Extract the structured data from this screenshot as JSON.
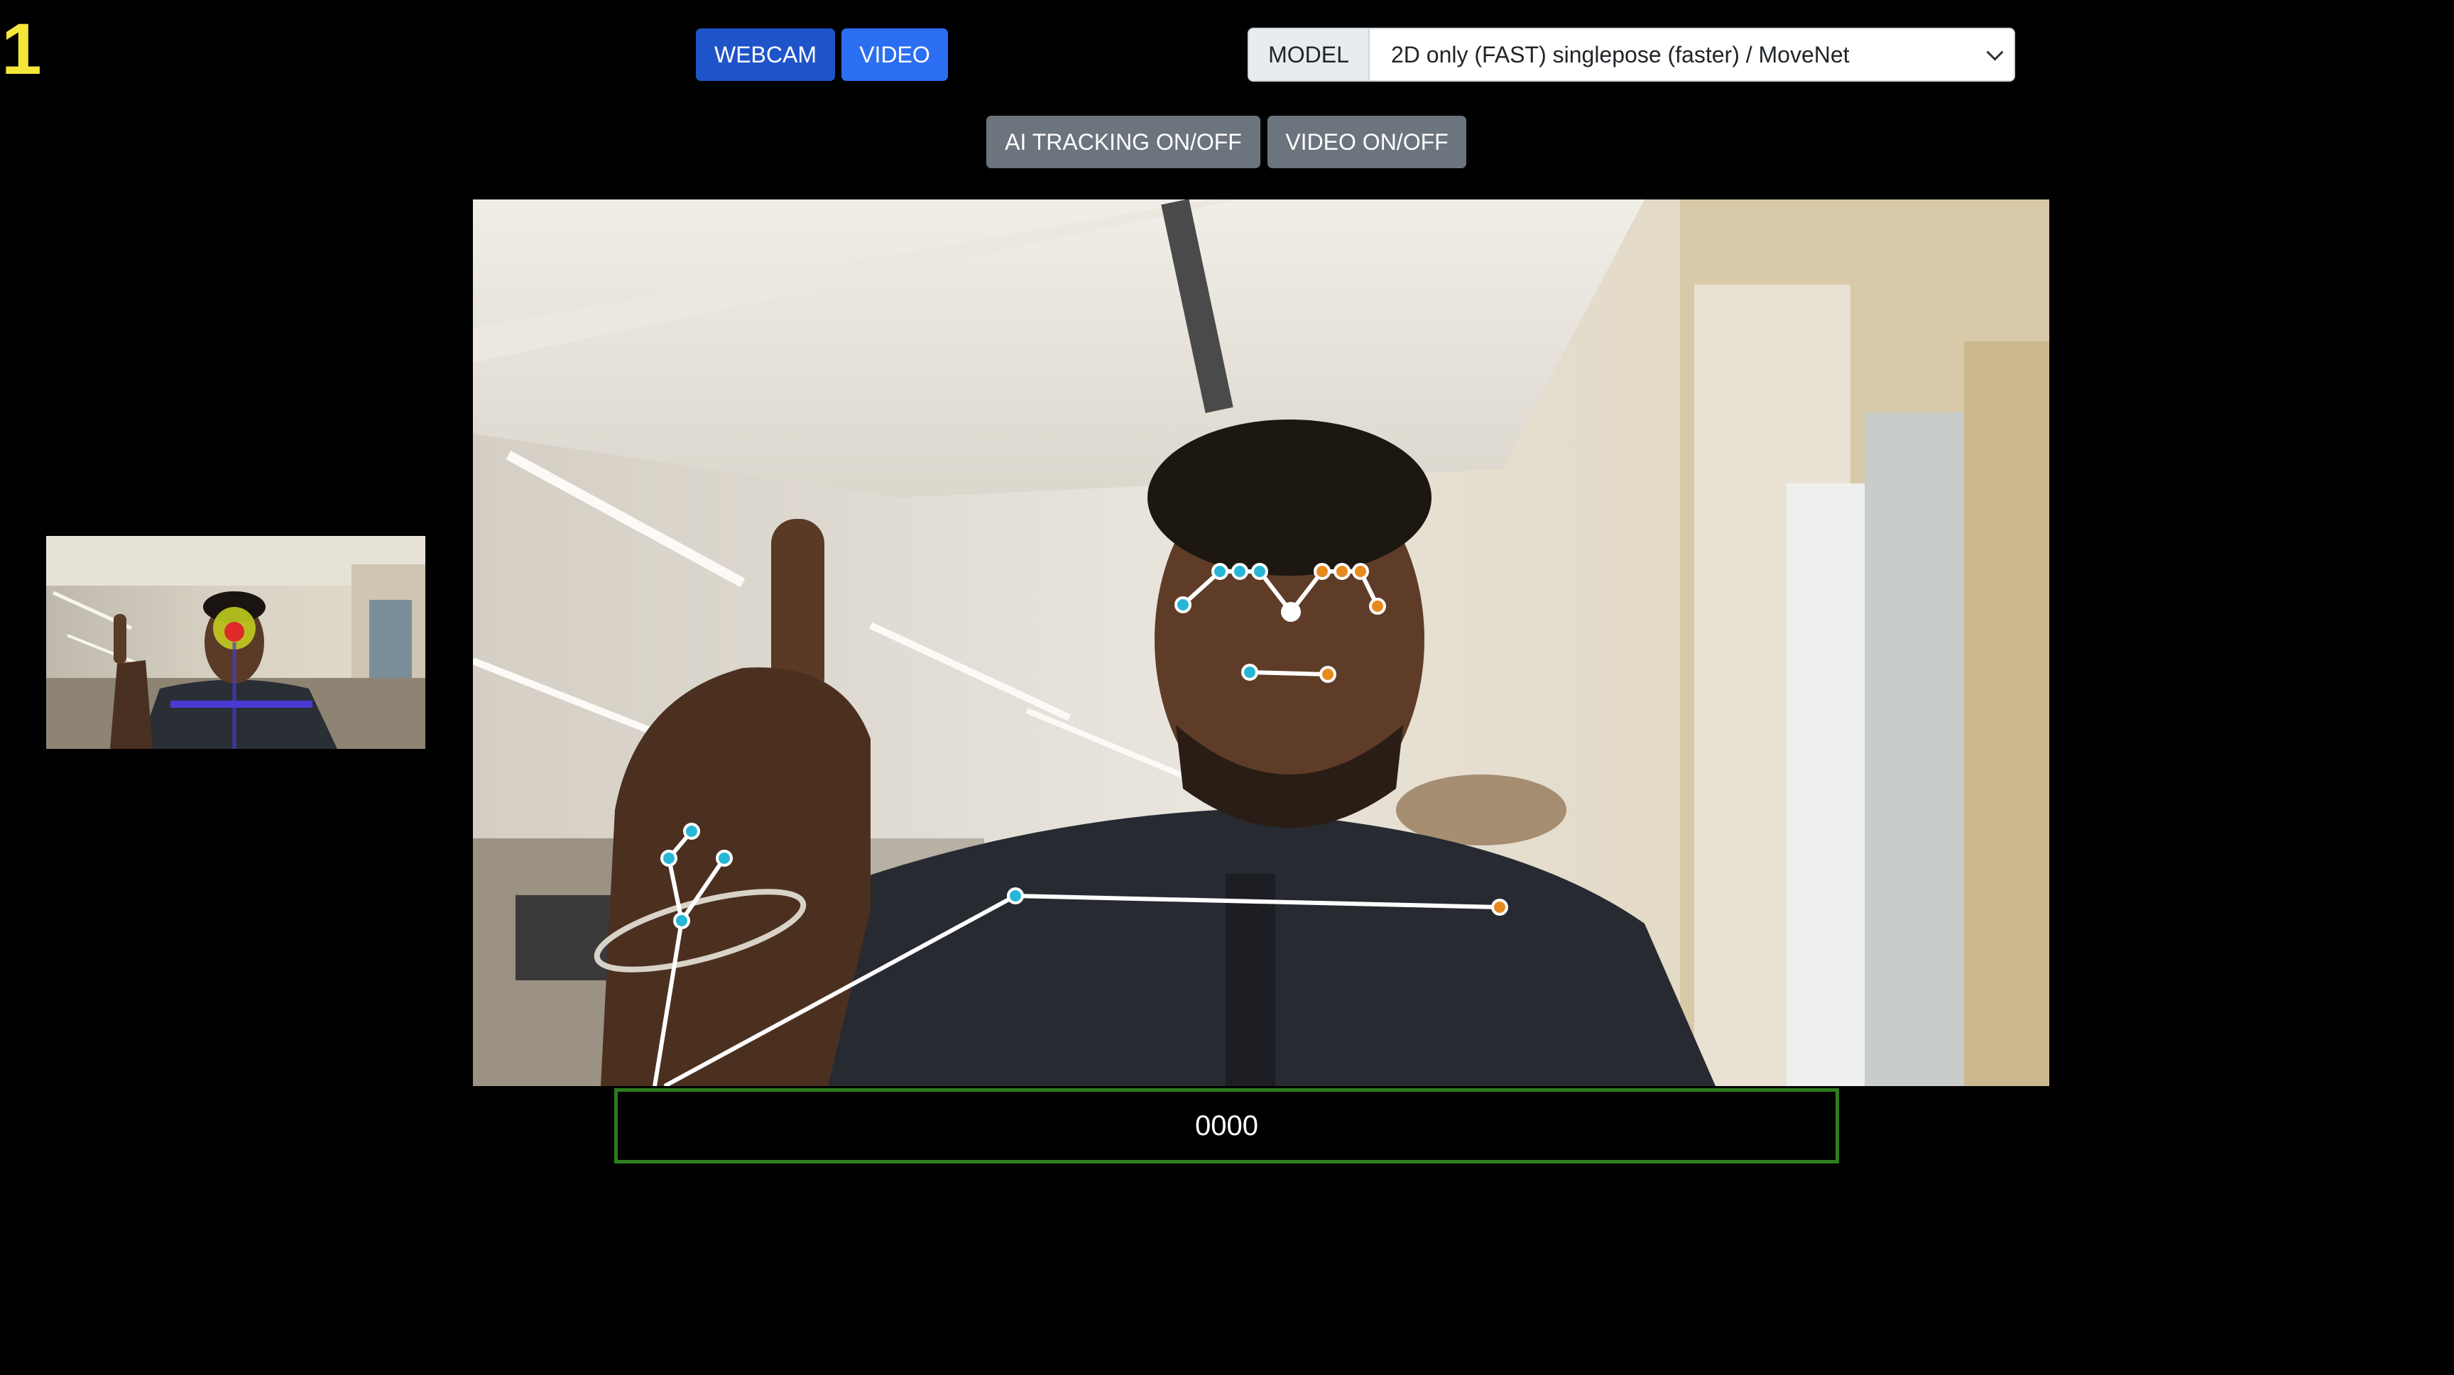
{
  "counter": "1",
  "source_buttons": {
    "webcam_label": "WEBCAM",
    "video_label": "VIDEO"
  },
  "model": {
    "label": "MODEL",
    "selected": "2D only (FAST) singlepose (faster) / MoveNet"
  },
  "toggles": {
    "ai_tracking_label": "AI TRACKING ON/OFF",
    "video_label": "VIDEO ON/OFF"
  },
  "score": "0000",
  "icons": {
    "select_caret": "chevron-down-icon"
  },
  "colors": {
    "counter": "#f5e63a",
    "webcam_button": "#1f54c9",
    "video_button": "#2c6ef2",
    "toggle_button": "#6c757d",
    "score_border": "#2e7d1f",
    "keypoint_left": "#27b6d6",
    "keypoint_right": "#e8891e",
    "skeleton": "#ffffff"
  }
}
